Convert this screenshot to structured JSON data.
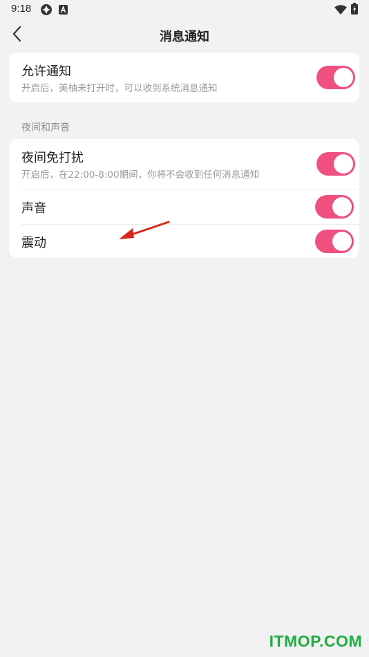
{
  "status_bar": {
    "time": "9:18",
    "icons": [
      "aperture-icon",
      "a-notification-icon",
      "wifi-icon",
      "battery-icon"
    ]
  },
  "header": {
    "title": "消息通知",
    "back_icon": "chevron-left-icon"
  },
  "allow_card": {
    "title": "允许通知",
    "description": "开启后，美柚未打开时，可以收到系统消息通知",
    "enabled": true
  },
  "night_section": {
    "label": "夜间和声音",
    "items": [
      {
        "title": "夜间免打扰",
        "description": "开启后，在22:00-8:00期间，你将不会收到任何消息通知",
        "enabled": true
      },
      {
        "title": "声音",
        "enabled": true
      },
      {
        "title": "震动",
        "enabled": true
      }
    ]
  },
  "colors": {
    "toggle_on": "#f0507e",
    "background": "#f2f2f4",
    "card": "#ffffff",
    "annotation_arrow": "#d9261c",
    "watermark": "#1fae3f"
  },
  "watermark": "ITMOP.COM"
}
